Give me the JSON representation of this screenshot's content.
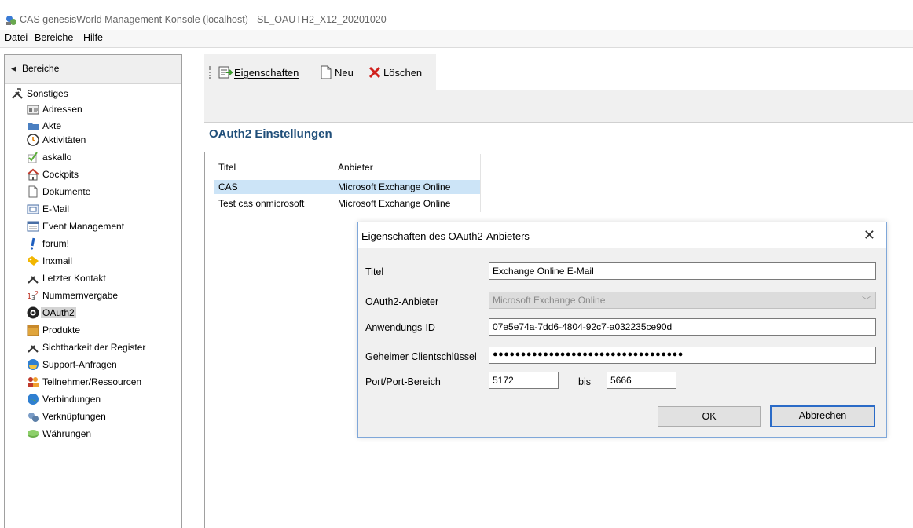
{
  "window": {
    "title": "CAS genesisWorld Management Konsole (localhost) - SL_OAUTH2_X12_20201020",
    "icon": "app-icon"
  },
  "menu": [
    "Datei",
    "Bereiche",
    "Hilfe"
  ],
  "sidebar": {
    "header": "Bereiche",
    "root": "Sonstiges",
    "items": [
      {
        "label": "Adressen",
        "icon": "address-card-icon"
      },
      {
        "label": "Akte",
        "icon": "folder-icon"
      },
      {
        "label": "Aktivitäten",
        "icon": "clock-icon"
      },
      {
        "label": "askallo",
        "icon": "checkmark-icon"
      },
      {
        "label": "Cockpits",
        "icon": "house-icon"
      },
      {
        "label": "Dokumente",
        "icon": "document-icon"
      },
      {
        "label": "E-Mail",
        "icon": "email-icon"
      },
      {
        "label": "Event Management",
        "icon": "event-icon"
      },
      {
        "label": "forum!",
        "icon": "exclamation-icon"
      },
      {
        "label": "Inxmail",
        "icon": "tag-icon"
      },
      {
        "label": "Letzter Kontakt",
        "icon": "tools-icon"
      },
      {
        "label": "Nummernvergabe",
        "icon": "numbering-icon"
      },
      {
        "label": "OAuth2",
        "icon": "oauth-icon"
      },
      {
        "label": "Produkte",
        "icon": "box-icon"
      },
      {
        "label": "Sichtbarkeit der Register",
        "icon": "tools-icon"
      },
      {
        "label": "Support-Anfragen",
        "icon": "support-icon"
      },
      {
        "label": "Teilnehmer/Ressourcen",
        "icon": "people-icon"
      },
      {
        "label": "Verbindungen",
        "icon": "globe-icon"
      },
      {
        "label": "Verknüpfungen",
        "icon": "link-icon"
      },
      {
        "label": "Währungen",
        "icon": "money-icon"
      }
    ],
    "selected": "OAuth2"
  },
  "toolbar": {
    "properties": "Eigenschaften",
    "new": "Neu",
    "delete": "Löschen"
  },
  "section_title": "OAuth2 Einstellungen",
  "grid": {
    "columns": [
      "Titel",
      "Anbieter"
    ],
    "rows": [
      {
        "title": "CAS",
        "provider": "Microsoft Exchange Online"
      },
      {
        "title": "Test cas onmicrosoft",
        "provider": "Microsoft Exchange Online"
      }
    ]
  },
  "dialog": {
    "title": "Eigenschaften des OAuth2-Anbieters",
    "fields": {
      "titel_label": "Titel",
      "titel_value": "Exchange Online E-Mail",
      "provider_label": "OAuth2-Anbieter",
      "provider_value": "Microsoft Exchange Online",
      "appid_label": "Anwendungs-ID",
      "appid_value": "07e5e74a-7dd6-4804-92c7-a032235ce90d",
      "secret_label": "Geheimer Clientschlüssel",
      "secret_value": "●●●●●●●●●●●●●●●●●●●●●●●●●●●●●●●●●●",
      "port_label": "Port/Port-Bereich",
      "port_from": "5172",
      "port_to_label": "bis",
      "port_to": "5666"
    },
    "ok": "OK",
    "cancel": "Abbrechen"
  },
  "colors": {
    "section_title": "#1f4e79",
    "selected_row": "#cce4f7",
    "dialog_border": "#7fa7d9"
  }
}
